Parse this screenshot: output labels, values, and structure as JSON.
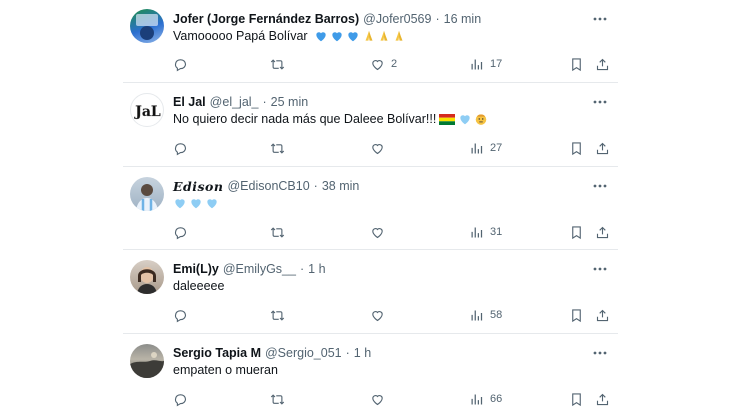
{
  "colors": {
    "text": "#0f1419",
    "secondary": "#536471",
    "divider": "#e6e9ec",
    "light_blue_heart": "#8ecdf4",
    "blue_heart": "#3f9be8"
  },
  "tweets": [
    {
      "name": "Jofer (Jorge Fernández Barros)",
      "handle": "@Jofer0569",
      "time": "16 min",
      "text": "Vamooooo Papá Bolívar",
      "emojis": [
        "blue-heart",
        "blue-heart",
        "blue-heart",
        "folded-hands",
        "folded-hands",
        "folded-hands"
      ],
      "likes": "2",
      "views": "17"
    },
    {
      "name": "El Jal",
      "handle": "@el_jal_",
      "time": "25 min",
      "text": "No quiero decir nada más que Daleee Bolívar!!!",
      "emojis": [
        "bolivia-flag",
        "light-blue-heart",
        "face-emoji"
      ],
      "likes": "",
      "views": "27"
    },
    {
      "name": "Edison",
      "handle": "@EdisonCB10",
      "time": "38 min",
      "text": "",
      "emojis": [
        "light-blue-heart",
        "light-blue-heart",
        "light-blue-heart"
      ],
      "likes": "",
      "views": "31"
    },
    {
      "name": "Emi(L)y",
      "handle": "@EmilyGs__",
      "time": "1 h",
      "text": "daleeeee",
      "emojis": [],
      "likes": "",
      "views": "58"
    },
    {
      "name": "Sergio Tapia M",
      "handle": "@Sergio_051",
      "time": "1 h",
      "text": "empaten o mueran",
      "emojis": [],
      "likes": "",
      "views": "66"
    }
  ],
  "separator": "·"
}
